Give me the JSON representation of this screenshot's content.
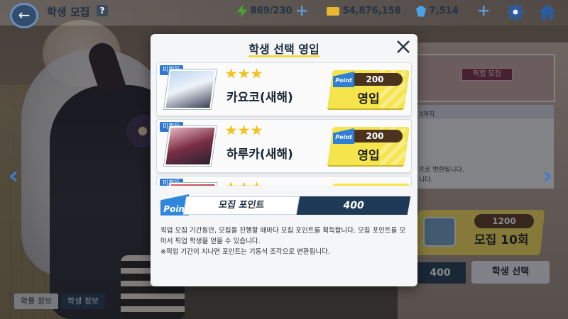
{
  "header": {
    "title": "학생 모집",
    "help_icon": "?",
    "ap": "869/230",
    "credits": "54,876,158",
    "gems": "7,514",
    "plus_label": "+"
  },
  "background": {
    "event_tag": "픽업 모집",
    "info_line_1": "3까지",
    "info_line_2": "프로 변환됩니다.",
    "info_line_3": "니다.",
    "recruit10_cost": "1200",
    "recruit10_label": "모집 10회",
    "mail_badge": "10",
    "points_value": "400",
    "student_select_label": "학생 선택"
  },
  "tabs": {
    "probability": "확률 정보",
    "student_info": "학생 정보"
  },
  "modal": {
    "title": "학생 선택 영입",
    "close_label": "×",
    "items": [
      {
        "badge": "미획득",
        "stars": 3,
        "name": "카요코(새해)",
        "cost": "200",
        "button_label": "영입"
      },
      {
        "badge": "미획득",
        "stars": 3,
        "name": "하루카(새해)",
        "cost": "200",
        "button_label": "영입"
      },
      {
        "badge": "미획득",
        "stars": 3,
        "name": "",
        "cost": "",
        "button_label": ""
      }
    ],
    "point_icon_text": "Point",
    "point_label": "모집 포인트",
    "point_value": "400",
    "description_1": "픽업 모집 기간동안, 모집을 진행할 때마다 모집 포인트를 획득합니다. 모집 포인트를 모아서 픽업 학생을 얻을 수 있습니다.",
    "description_2": "※픽업 기간이 지나면 포인트는 기동석 조각으로 변환됩니다."
  },
  "colors": {
    "accent_yellow": "#f6e44d",
    "navy": "#1f3a57",
    "badge_blue": "#2c79d2"
  }
}
